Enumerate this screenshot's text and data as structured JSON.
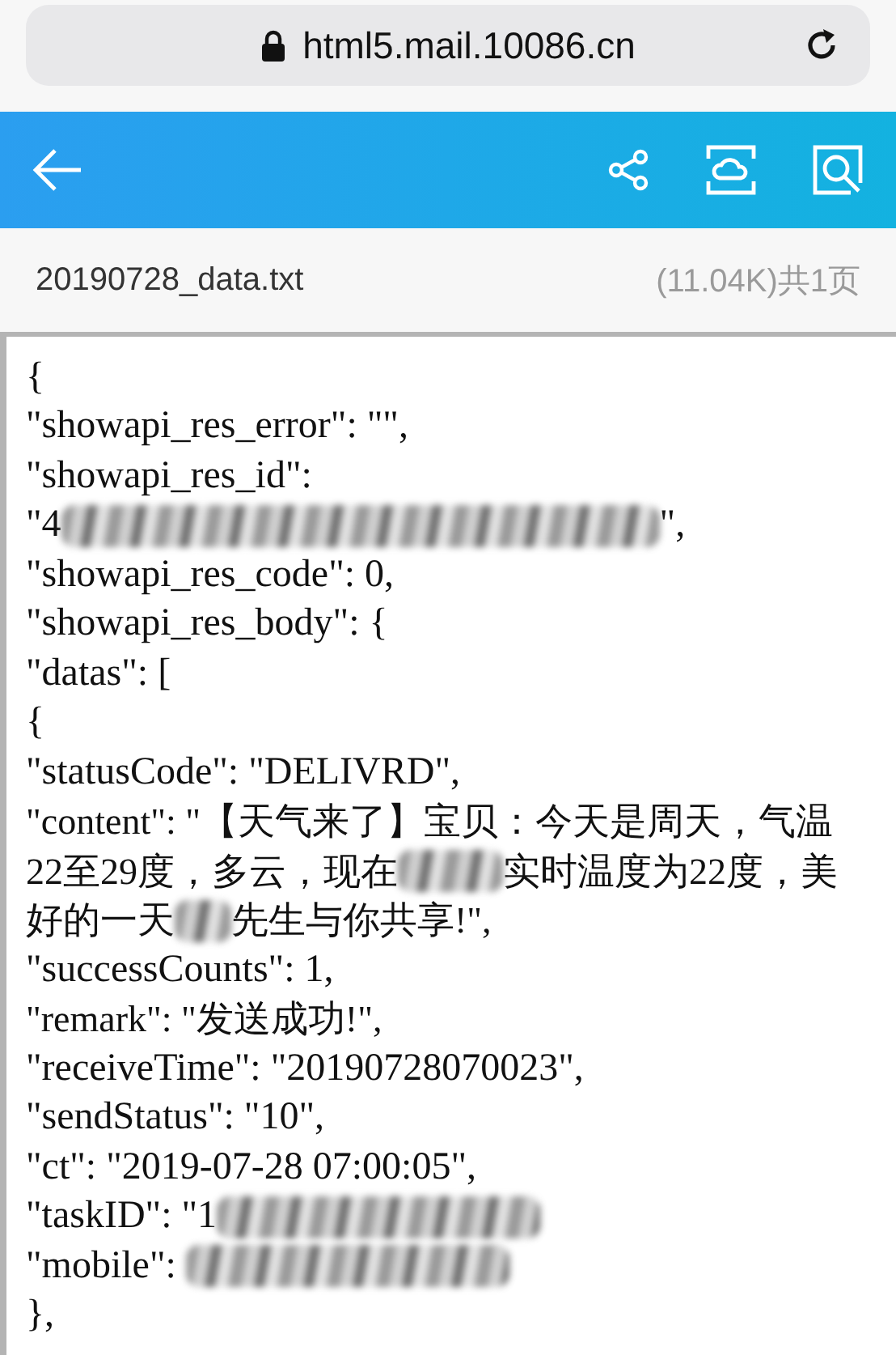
{
  "address_bar": {
    "url": "html5.mail.10086.cn"
  },
  "file_bar": {
    "name": "20190728_data.txt",
    "info": "(11.04K)共1页"
  },
  "document": {
    "lines": [
      [
        {
          "kind": "text",
          "text": "{"
        }
      ],
      [
        {
          "kind": "text",
          "text": "\"showapi_res_error\": \"\","
        }
      ],
      [
        {
          "kind": "text",
          "text": "\"showapi_res_id\":"
        }
      ],
      [
        {
          "kind": "text",
          "text": "\"4"
        },
        {
          "kind": "smudge"
        },
        {
          "kind": "text",
          "text": "\","
        }
      ],
      [
        {
          "kind": "text",
          "text": "\"showapi_res_code\": 0,"
        }
      ],
      [
        {
          "kind": "text",
          "text": "\"showapi_res_body\": {"
        }
      ],
      [
        {
          "kind": "text",
          "text": "\"datas\": ["
        }
      ],
      [
        {
          "kind": "text",
          "text": "{"
        }
      ],
      [
        {
          "kind": "text",
          "text": "\"statusCode\": \"DELIVRD\","
        }
      ],
      [
        {
          "kind": "text",
          "text": "\"content\": \"【天气来了】宝贝：今天是周天，气温"
        }
      ],
      [
        {
          "kind": "text",
          "text": "22至29度，多云，现在"
        },
        {
          "kind": "smudge"
        },
        {
          "kind": "text",
          "text": "实时温度为22度，美"
        }
      ],
      [
        {
          "kind": "text",
          "text": "好的一天"
        },
        {
          "kind": "smudge"
        },
        {
          "kind": "text",
          "text": "先生与你共享!\","
        }
      ],
      [
        {
          "kind": "text",
          "text": "\"successCounts\": 1,"
        }
      ],
      [
        {
          "kind": "text",
          "text": "\"remark\": \"发送成功!\","
        }
      ],
      [
        {
          "kind": "text",
          "text": "\"receiveTime\": \"20190728070023\","
        }
      ],
      [
        {
          "kind": "text",
          "text": "\"sendStatus\": \"10\","
        }
      ],
      [
        {
          "kind": "text",
          "text": "\"ct\": \"2019-07-28 07:00:05\","
        }
      ],
      [
        {
          "kind": "text",
          "text": "\"taskID\": \"1"
        },
        {
          "kind": "smudge"
        }
      ],
      [
        {
          "kind": "text",
          "text": "\"mobile\": "
        },
        {
          "kind": "smudge"
        }
      ],
      [
        {
          "kind": "text",
          "text": "},"
        }
      ]
    ]
  }
}
